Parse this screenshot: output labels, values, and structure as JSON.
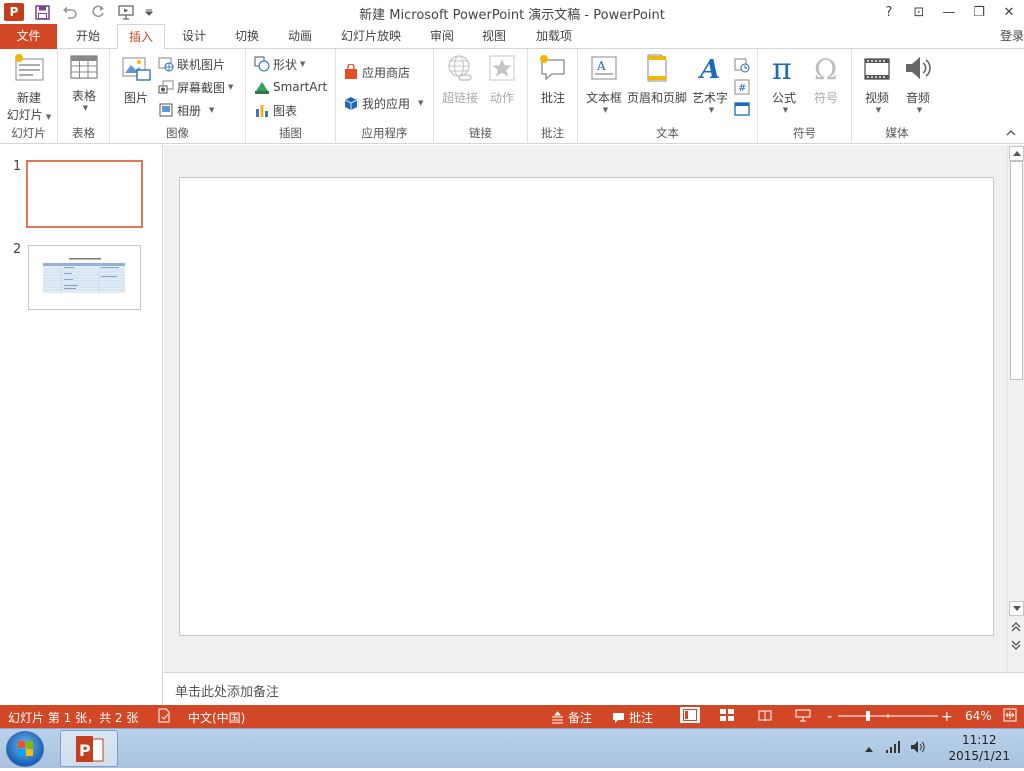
{
  "window": {
    "title": "新建 Microsoft PowerPoint 演示文稿 - PowerPoint",
    "app_icon_letter": "P",
    "help": "?",
    "ribbon_options": "⊡",
    "minimize": "—",
    "restore": "❐",
    "close": "✕"
  },
  "tabs": [
    {
      "label": "文件"
    },
    {
      "label": "开始"
    },
    {
      "label": "插入"
    },
    {
      "label": "设计"
    },
    {
      "label": "切换"
    },
    {
      "label": "动画"
    },
    {
      "label": "幻灯片放映"
    },
    {
      "label": "审阅"
    },
    {
      "label": "视图"
    },
    {
      "label": "加载项"
    }
  ],
  "active_tab": "插入",
  "login": "登录",
  "ribbon": {
    "slides": {
      "label": "幻灯片",
      "new_slide_1": "新建",
      "new_slide_2": "幻灯片"
    },
    "tables": {
      "label": "表格",
      "table": "表格"
    },
    "images": {
      "label": "图像",
      "picture": "图片",
      "online_picture": "联机图片",
      "screenshot": "屏幕截图",
      "album": "相册"
    },
    "illustrations": {
      "label": "插图",
      "shapes": "形状",
      "smartart": "SmartArt",
      "chart": "图表"
    },
    "apps": {
      "label": "应用程序",
      "store": "应用商店",
      "my_apps": "我的应用"
    },
    "links": {
      "label": "链接",
      "hyperlink": "超链接",
      "action": "动作"
    },
    "comments": {
      "label": "批注",
      "comment": "批注"
    },
    "text": {
      "label": "文本",
      "textbox": "文本框",
      "header_footer": "页眉和页脚",
      "wordart": "艺术字"
    },
    "symbols": {
      "label": "符号",
      "equation": "公式",
      "symbol": "符号"
    },
    "media": {
      "label": "媒体",
      "video": "视频",
      "audio": "音频"
    }
  },
  "thumbnails": [
    {
      "number": "1",
      "selected": true
    },
    {
      "number": "2",
      "selected": false
    }
  ],
  "notes_placeholder": "单击此处添加备注",
  "status": {
    "slide_info": "幻灯片 第 1 张，共 2 张",
    "language": "中文(中国)",
    "notes": "备注",
    "comments": "批注",
    "zoom": "64%",
    "zoom_minus": "-",
    "zoom_plus": "+"
  },
  "taskbar": {
    "time": "11:12",
    "date": "2015/1/21"
  },
  "colors": {
    "accent": "#d24726",
    "thumb_selected": "#e07856"
  }
}
